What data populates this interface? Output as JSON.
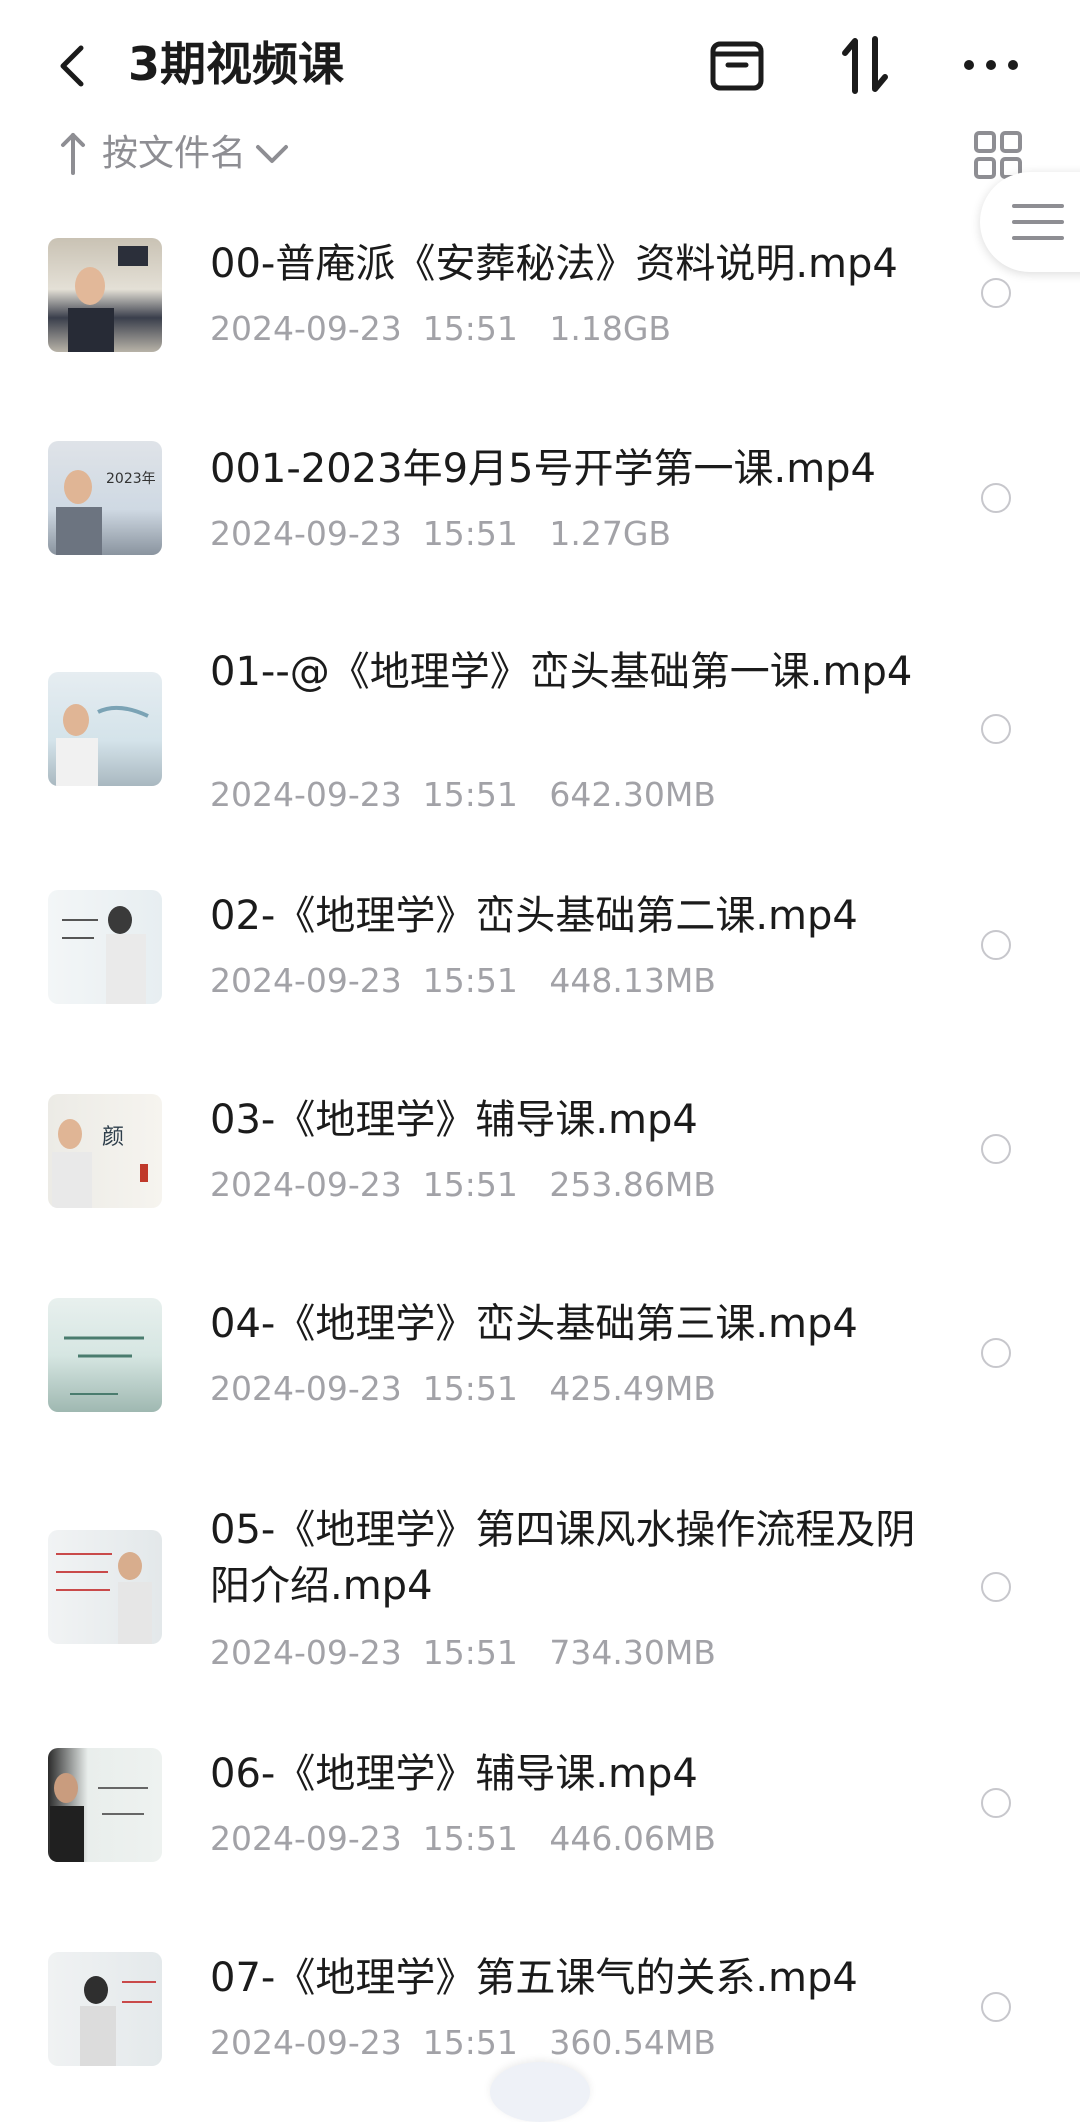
{
  "header": {
    "title": "3期视频课",
    "back_icon": "chevron-left-icon",
    "actions": [
      "archive-box-icon",
      "sort-updown-icon",
      "more-horizontal-icon"
    ]
  },
  "sort": {
    "label": "按文件名",
    "arrow_icon": "arrow-up-icon",
    "chevron_icon": "chevron-down-icon",
    "view_toggle_icon": "grid-view-icon"
  },
  "side_handle": {
    "icon": "menu-lines-icon"
  },
  "files": [
    {
      "name": "00-普庵派《安葬秘法》资料说明.mp4",
      "date": "2024-09-23",
      "time": "15:51",
      "size": "1.18GB"
    },
    {
      "name": "001-2023年9月5号开学第一课.mp4",
      "date": "2024-09-23",
      "time": "15:51",
      "size": "1.27GB"
    },
    {
      "name": "01--@《地理学》峦头基础第一课.mp4",
      "date": "2024-09-23",
      "time": "15:51",
      "size": "642.30MB"
    },
    {
      "name": "02-《地理学》峦头基础第二课.mp4",
      "date": "2024-09-23",
      "time": "15:51",
      "size": "448.13MB"
    },
    {
      "name": "03-《地理学》辅导课.mp4",
      "date": "2024-09-23",
      "time": "15:51",
      "size": "253.86MB"
    },
    {
      "name": "04-《地理学》峦头基础第三课.mp4",
      "date": "2024-09-23",
      "time": "15:51",
      "size": "425.49MB"
    },
    {
      "name": "05-《地理学》第四课风水操作流程及阴阳介绍.mp4",
      "date": "2024-09-23",
      "time": "15:51",
      "size": "734.30MB"
    },
    {
      "name": "06-《地理学》辅导课.mp4",
      "date": "2024-09-23",
      "time": "15:51",
      "size": "446.06MB"
    },
    {
      "name": "07-《地理学》第五课气的关系.mp4",
      "date": "2024-09-23",
      "time": "15:51",
      "size": "360.54MB"
    }
  ],
  "colors": {
    "text_primary": "#1b1b1b",
    "text_secondary": "#a2a2a7",
    "icon_dark": "#1b1b1b",
    "radio_border": "#c7c7cc"
  }
}
